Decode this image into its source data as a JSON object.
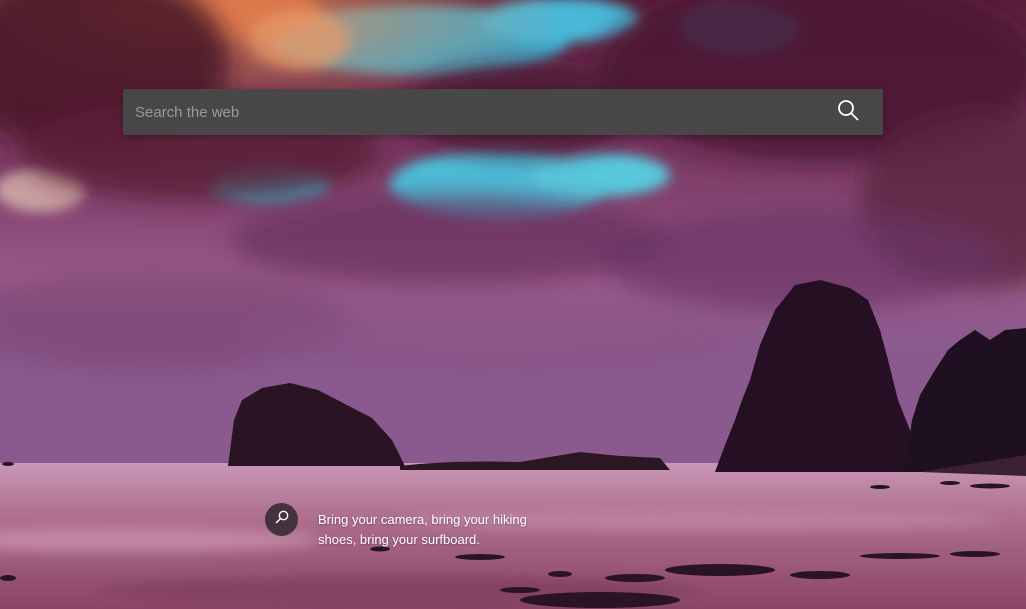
{
  "search": {
    "placeholder": "Search the web",
    "value": "",
    "icon": "search-icon"
  },
  "background": {
    "description_icon": "magnifier-icon",
    "caption": "Bring your camera, bring your hiking shoes, bring your surfboard."
  },
  "colors": {
    "search_bar": "#484848",
    "sky_blue": "#3fb6d4",
    "sunset_orange": "#d4664a",
    "cloud_magenta": "#8a4a78",
    "sea": "#b07a9a"
  }
}
